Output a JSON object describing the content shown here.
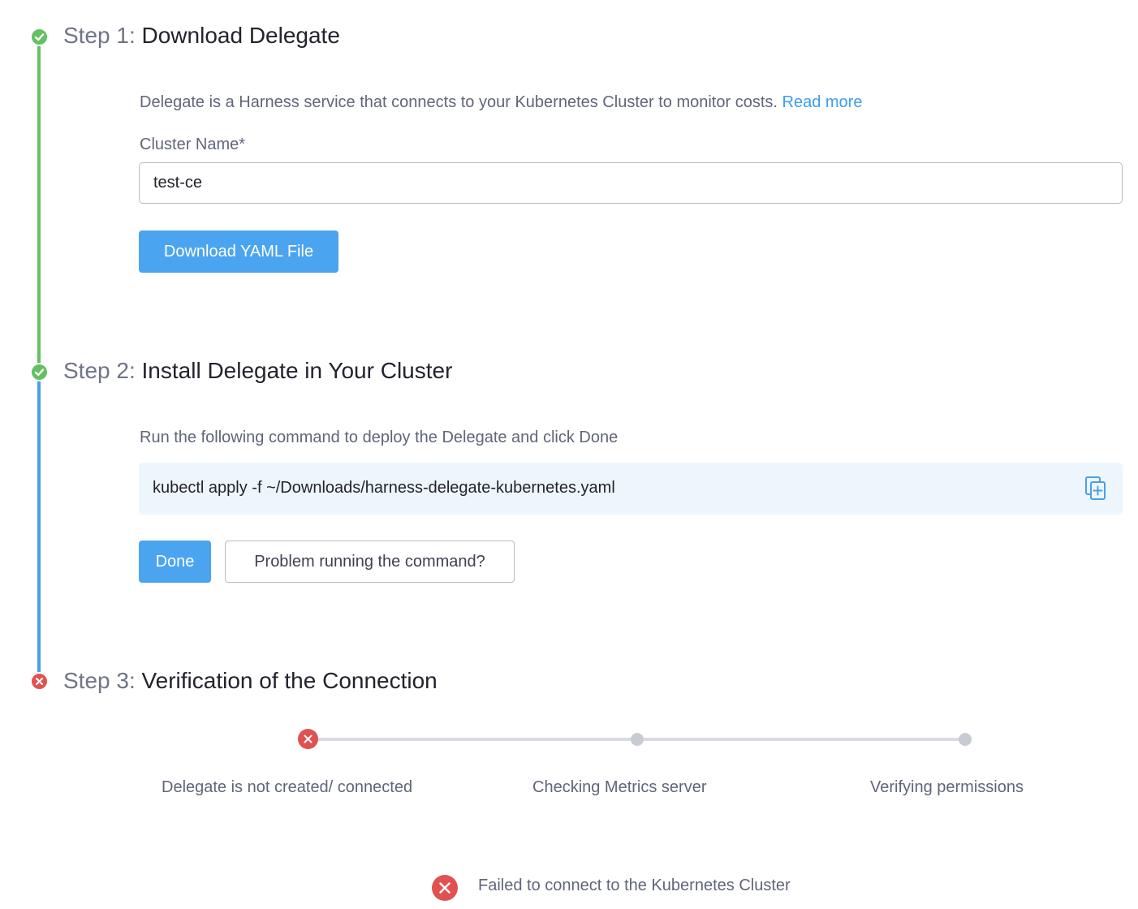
{
  "steps": [
    {
      "prefix": "Step 1:",
      "title": "Download Delegate",
      "status": "complete",
      "description": "Delegate is a Harness service that connects to your Kubernetes Cluster to monitor costs.",
      "link_label": "Read more",
      "field_label": "Cluster Name*",
      "field_value": "test-ce",
      "button_label": "Download YAML File"
    },
    {
      "prefix": "Step 2:",
      "title": "Install Delegate in Your Cluster",
      "status": "complete",
      "description": "Run the following command to deploy the Delegate and click Done",
      "command": "kubectl apply -f ~/Downloads/harness-delegate-kubernetes.yaml",
      "copy_icon": "copy-icon",
      "done_label": "Done",
      "problem_label": "Problem running the command?"
    },
    {
      "prefix": "Step 3:",
      "title": "Verification of the Connection",
      "status": "error",
      "progress": [
        {
          "label": "Delegate is not created/ connected",
          "state": "error"
        },
        {
          "label": "Checking Metrics server",
          "state": "pending"
        },
        {
          "label": "Verifying permissions",
          "state": "pending"
        }
      ],
      "error_message": "Failed to connect to the Kubernetes Cluster"
    }
  ],
  "colors": {
    "success": "#63c163",
    "in_progress": "#4a9fe8",
    "error": "#e05252",
    "primary_button": "#4ba4f0",
    "link": "#3b9cf2"
  }
}
